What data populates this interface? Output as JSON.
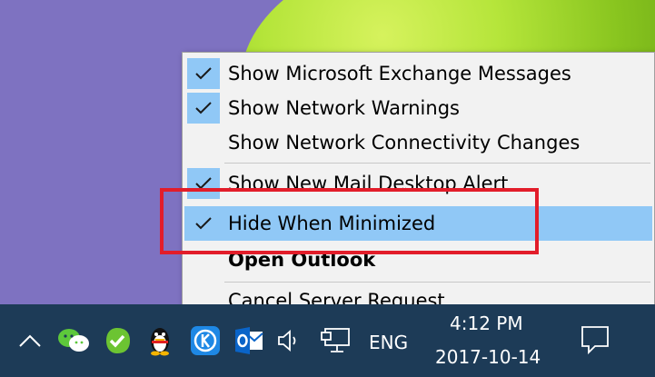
{
  "menu": {
    "items": [
      {
        "label": "Show Microsoft Exchange Messages",
        "checked": true
      },
      {
        "label": "Show Network Warnings",
        "checked": true
      },
      {
        "label": "Show Network Connectivity Changes",
        "checked": false
      },
      {
        "label": "Show New Mail Desktop Alert",
        "checked": true
      },
      {
        "label": "Hide When Minimized",
        "checked": true,
        "highlighted": true
      },
      {
        "label": "Open Outlook",
        "bold": true
      },
      {
        "label": "Cancel Server Request"
      }
    ]
  },
  "taskbar": {
    "language": "ENG",
    "time": "4:12 PM",
    "date": "2017-10-14",
    "icons": [
      "chevron-up-icon",
      "wechat-icon",
      "checkmark-app-icon",
      "qq-penguin-icon",
      "k-app-icon",
      "outlook-icon",
      "speaker-icon",
      "network-icon",
      "notification-icon"
    ]
  },
  "colors": {
    "menu_bg": "#f2f2f2",
    "highlight": "#90c8f6",
    "annotation": "#e21d2a",
    "taskbar": "#1d3b57",
    "desktop": "#7e72c1"
  }
}
